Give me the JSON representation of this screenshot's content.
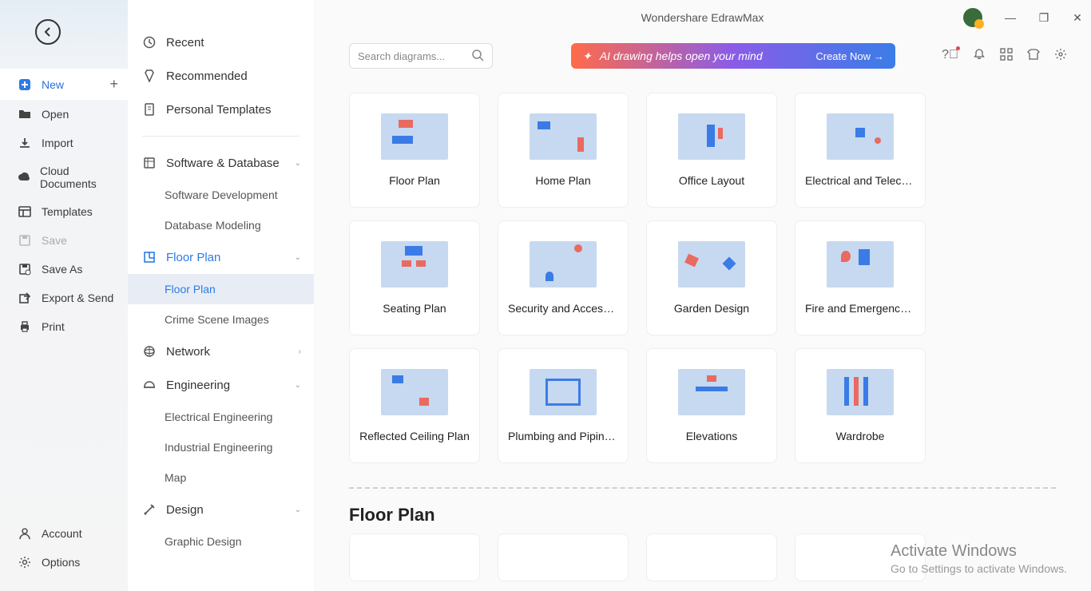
{
  "app": {
    "title": "Wondershare EdrawMax"
  },
  "narrow": {
    "items": [
      {
        "id": "new",
        "label": "New",
        "icon": "plus",
        "plus": true,
        "active": true
      },
      {
        "id": "open",
        "label": "Open",
        "icon": "folder"
      },
      {
        "id": "import",
        "label": "Import",
        "icon": "download"
      },
      {
        "id": "cloud",
        "label": "Cloud Documents",
        "icon": "cloud"
      },
      {
        "id": "templates",
        "label": "Templates",
        "icon": "templates"
      },
      {
        "id": "save",
        "label": "Save",
        "icon": "save",
        "disabled": true
      },
      {
        "id": "saveas",
        "label": "Save As",
        "icon": "saveas"
      },
      {
        "id": "export",
        "label": "Export & Send",
        "icon": "export"
      },
      {
        "id": "print",
        "label": "Print",
        "icon": "print"
      }
    ],
    "bottom": [
      {
        "id": "account",
        "label": "Account",
        "icon": "account"
      },
      {
        "id": "options",
        "label": "Options",
        "icon": "gear"
      }
    ]
  },
  "categories": {
    "top": [
      {
        "id": "recent",
        "label": "Recent",
        "icon": "clock"
      },
      {
        "id": "recommended",
        "label": "Recommended",
        "icon": "badge"
      },
      {
        "id": "personal",
        "label": "Personal Templates",
        "icon": "file"
      }
    ],
    "groups": [
      {
        "id": "software",
        "label": "Software & Database",
        "icon": "db",
        "subs": [
          "Software Development",
          "Database Modeling"
        ]
      },
      {
        "id": "floorplan",
        "label": "Floor Plan",
        "icon": "floor",
        "selected": true,
        "subs": [
          "Floor Plan",
          "Crime Scene Images"
        ],
        "selected_sub": 0
      },
      {
        "id": "network",
        "label": "Network",
        "icon": "net",
        "chev": "right",
        "subs": []
      },
      {
        "id": "engineering",
        "label": "Engineering",
        "icon": "helmet",
        "subs": [
          "Electrical Engineering",
          "Industrial Engineering",
          "Map"
        ]
      },
      {
        "id": "design",
        "label": "Design",
        "icon": "design",
        "subs": [
          "Graphic Design"
        ]
      }
    ]
  },
  "search": {
    "placeholder": "Search diagrams..."
  },
  "ai_banner": {
    "text": "AI drawing helps open your mind",
    "cta": "Create Now"
  },
  "templates": [
    {
      "label": "Floor Plan"
    },
    {
      "label": "Home Plan"
    },
    {
      "label": "Office Layout"
    },
    {
      "label": "Electrical and Telecom..."
    },
    {
      "label": "Seating Plan"
    },
    {
      "label": "Security and Access P..."
    },
    {
      "label": "Garden Design"
    },
    {
      "label": "Fire and Emergency P..."
    },
    {
      "label": "Reflected Ceiling Plan"
    },
    {
      "label": "Plumbing and Piping ..."
    },
    {
      "label": "Elevations"
    },
    {
      "label": "Wardrobe"
    }
  ],
  "section": {
    "title": "Floor Plan"
  },
  "watermark": {
    "title": "Activate Windows",
    "text": "Go to Settings to activate Windows."
  }
}
